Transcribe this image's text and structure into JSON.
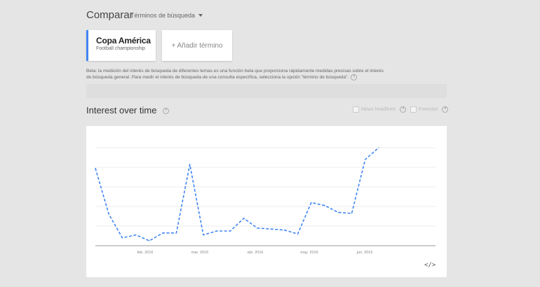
{
  "header": {
    "title": "Comparar",
    "dropdown_label": "Términos de búsqueda"
  },
  "terms": [
    {
      "name": "Copa América",
      "type": "Football championship"
    }
  ],
  "add_term_label": "+ Añadir término",
  "beta_note": "Beta: la medición del interés de búsqueda de diferentes temas es una función beta que proporciona rápidamente medidas precisas sobre el interés de búsqueda general. Para medir el interés de búsqueda de una consulta específica, selecciona la opción \"término de búsqueda\".",
  "interest": {
    "title": "Interest over time",
    "news_headlines_label": "News headlines",
    "forecast_label": "Forecast"
  },
  "colors": {
    "series": "#4285f4",
    "accent": "#4285f4"
  },
  "chart_data": {
    "type": "line",
    "x_ticks": [
      "feb. 2016",
      "mar. 2016",
      "abr. 2016",
      "may. 2016",
      "jun. 2016"
    ],
    "series": [
      {
        "name": "Copa América",
        "values": [
          79,
          32,
          8,
          11,
          5,
          13,
          13,
          83,
          11,
          15,
          15,
          28,
          18,
          17,
          16,
          12,
          44,
          41,
          34,
          33,
          88,
          100
        ]
      }
    ],
    "ylim": [
      0,
      100
    ],
    "grid": true,
    "line_style": "dashed"
  }
}
